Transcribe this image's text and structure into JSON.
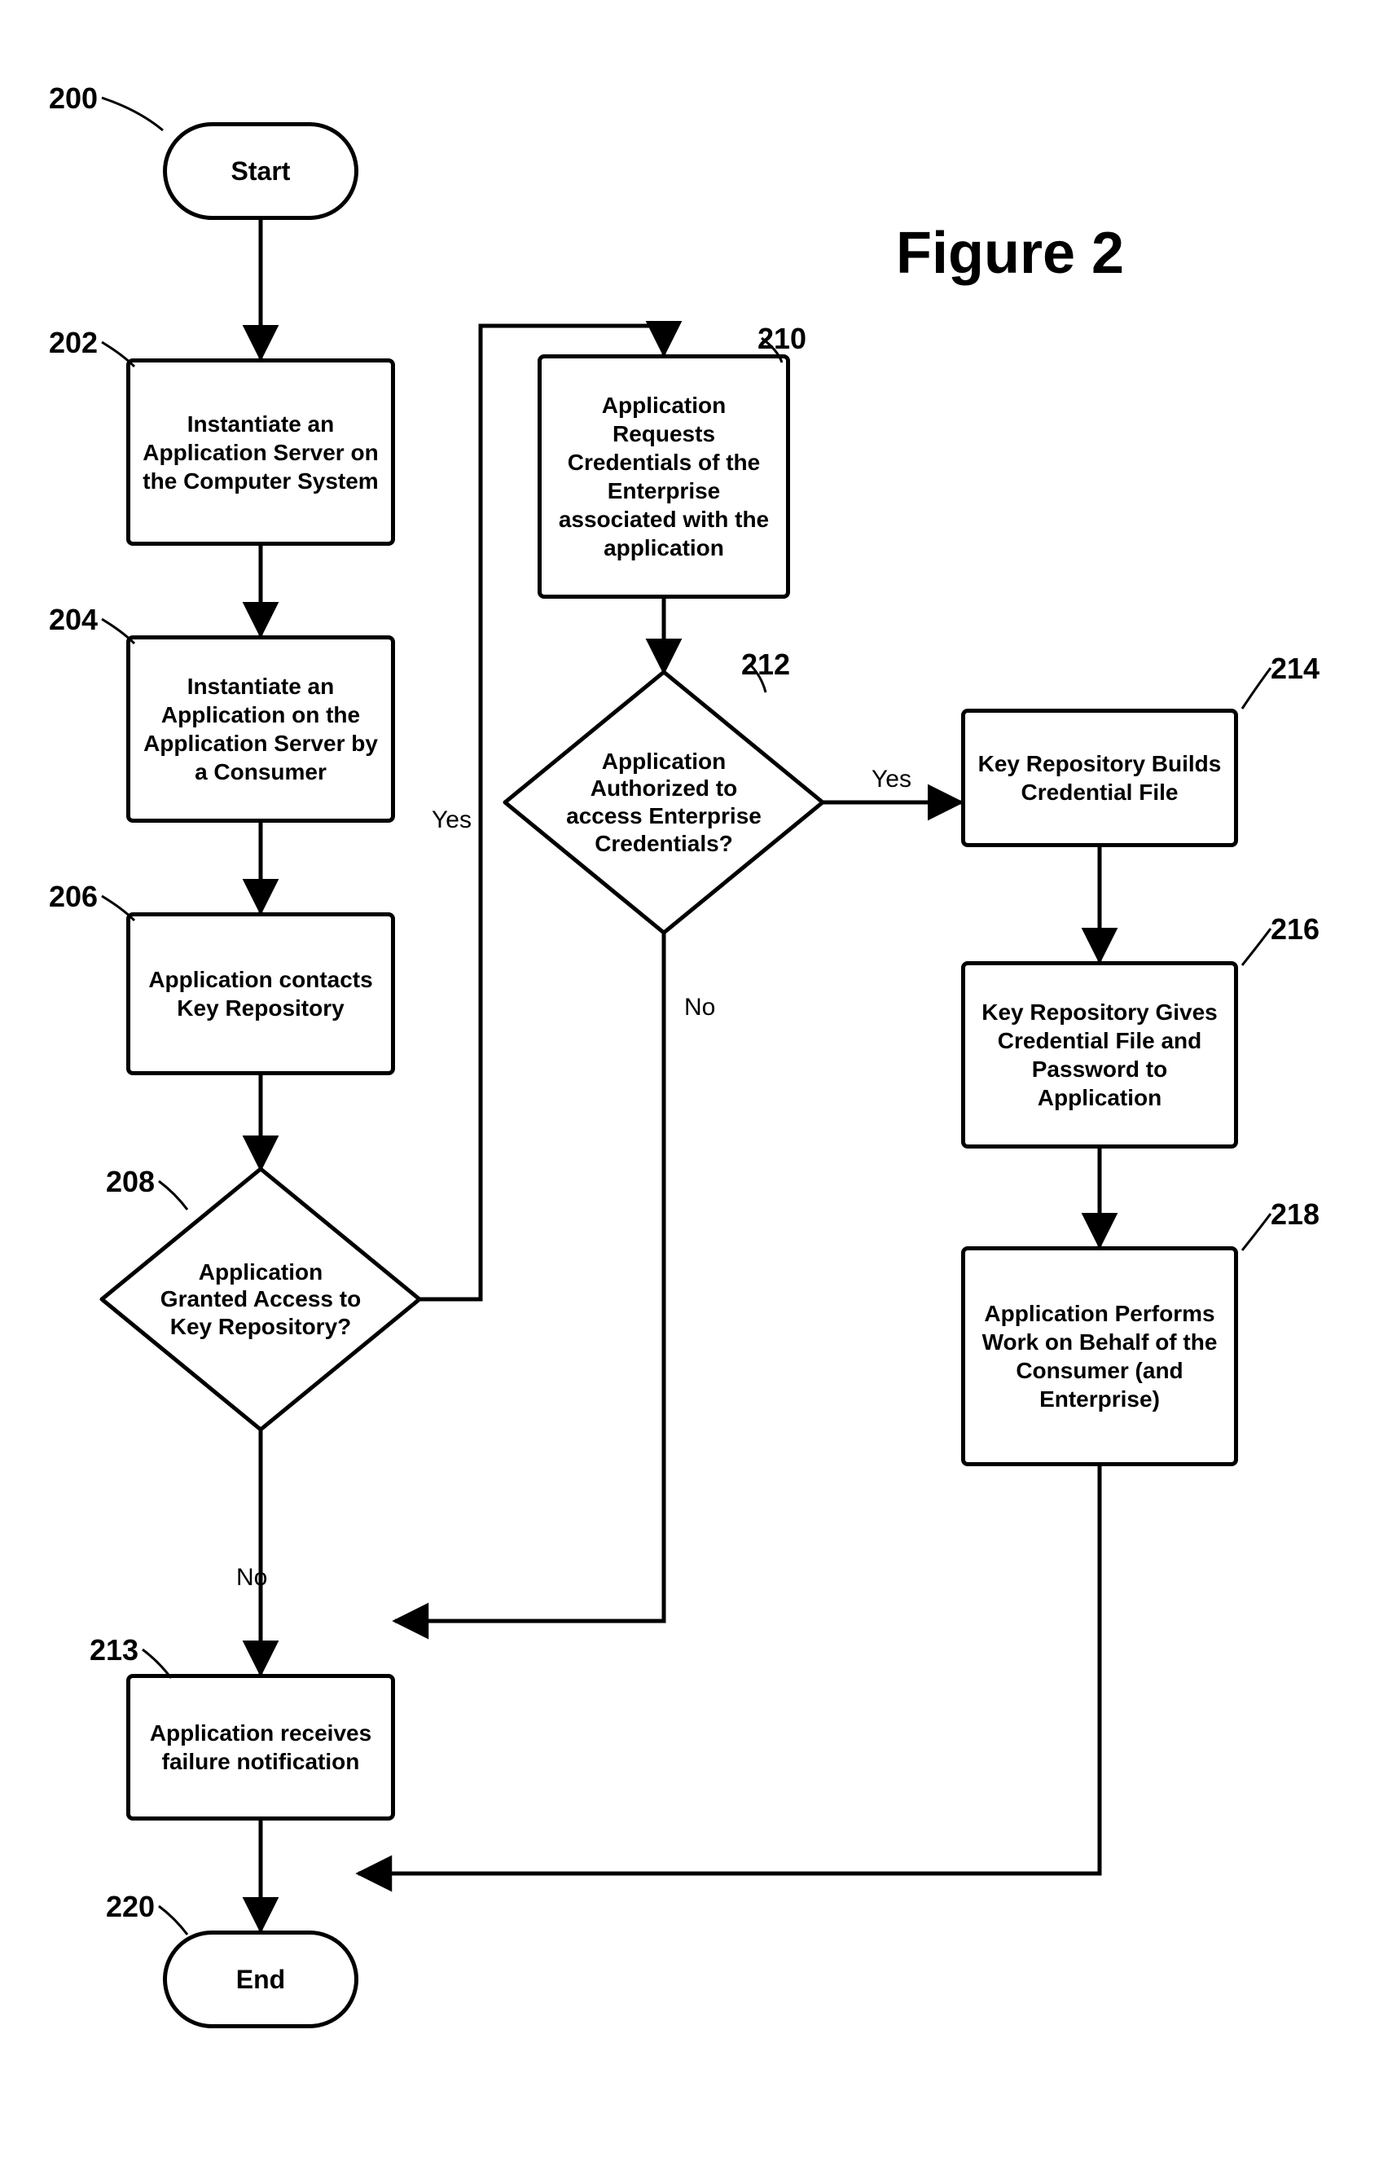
{
  "title": "Figure 2",
  "refs": {
    "r200": "200",
    "r202": "202",
    "r204": "204",
    "r206": "206",
    "r208": "208",
    "r210": "210",
    "r212": "212",
    "r213": "213",
    "r214": "214",
    "r216": "216",
    "r218": "218",
    "r220": "220"
  },
  "nodes": {
    "start": "Start",
    "end": "End",
    "n202": "Instantiate an Application Server on the Computer System",
    "n204": "Instantiate an Application on the Application Server by a Consumer",
    "n206": "Application contacts Key Repository",
    "n208": "Application Granted Access to Key Repository?",
    "n210": "Application Requests Credentials of the Enterprise associated with the application",
    "n212": "Application Authorized to access Enterprise Credentials?",
    "n213": "Application receives failure notification",
    "n214": "Key Repository Builds Credential File",
    "n216": "Key Repository Gives Credential File and Password to Application",
    "n218": "Application Performs Work on Behalf of the Consumer (and Enterprise)"
  },
  "labels": {
    "yes": "Yes",
    "no": "No"
  },
  "flow": {
    "type": "flowchart",
    "edges": [
      {
        "from": "start",
        "to": "n202"
      },
      {
        "from": "n202",
        "to": "n204"
      },
      {
        "from": "n204",
        "to": "n206"
      },
      {
        "from": "n206",
        "to": "n208"
      },
      {
        "from": "n208",
        "to": "n210",
        "label": "Yes"
      },
      {
        "from": "n208",
        "to": "n213",
        "label": "No"
      },
      {
        "from": "n210",
        "to": "n212"
      },
      {
        "from": "n212",
        "to": "n214",
        "label": "Yes"
      },
      {
        "from": "n212",
        "to": "n213",
        "label": "No"
      },
      {
        "from": "n214",
        "to": "n216"
      },
      {
        "from": "n216",
        "to": "n218"
      },
      {
        "from": "n213",
        "to": "end"
      },
      {
        "from": "n218",
        "to": "end"
      }
    ]
  }
}
